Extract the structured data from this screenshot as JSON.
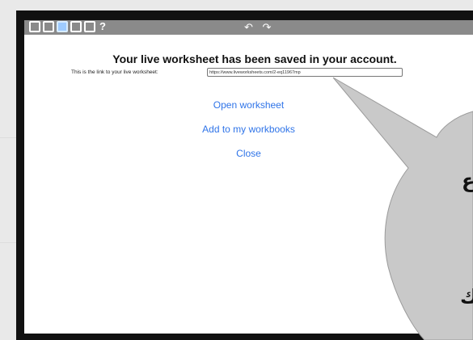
{
  "toolbar": {
    "icons": [
      "edit-icon",
      "search-doc-icon",
      "page-icon",
      "copy-doc-icon",
      "export-icon",
      "help-icon"
    ],
    "help_label": "?",
    "undo_redo_label": "↶ ↷",
    "active_color": "#9ecbff"
  },
  "dialog": {
    "title": "Your live worksheet has been saved in your account.",
    "link_label": "This is the link to your live worksheet:",
    "link_value": "https://www.liveworksheets.com/2-eq11967mp",
    "open_label": "Open worksheet",
    "add_label": "Add to my workbooks",
    "close_label": "Close",
    "link_color": "#2f74e8"
  },
  "callout": {
    "visible_text": [
      "ع",
      "ك"
    ],
    "color": "#c9c9c9"
  }
}
